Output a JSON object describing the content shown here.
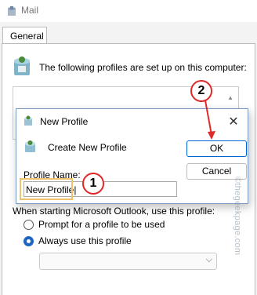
{
  "mail_window": {
    "title": "Mail",
    "tab_label": "General",
    "profiles_text": "The following profiles are set up on this computer:",
    "startup_label": "When starting Microsoft Outlook, use this profile:",
    "radio_prompt": "Prompt for a profile to be used",
    "radio_always": "Always use this profile",
    "selected_radio": "always"
  },
  "dialog": {
    "title": "New Profile",
    "create_label": "Create New Profile",
    "ok_label": "OK",
    "cancel_label": "Cancel",
    "name_label": "Profile Name:",
    "name_value": "New Profile"
  },
  "annotations": {
    "step1": "1",
    "step2": "2",
    "color": "#e02828",
    "highlight_color": "#f2c36d"
  },
  "watermark": "©thegeekpage.com"
}
